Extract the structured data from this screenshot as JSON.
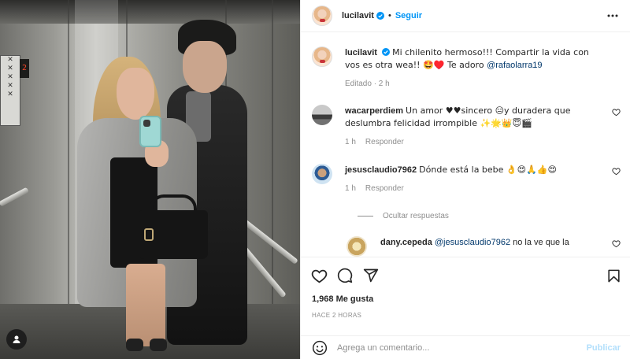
{
  "post": {
    "author": "lucilavit",
    "follow_label": "Seguir",
    "separator": "•"
  },
  "caption": {
    "username": "lucilavit",
    "text": "Mi chilenito hermoso!!! Compartir la vida con vos es otra wea!! 🤩♥️ Te adoro ",
    "mention": "@rafaolarra19",
    "meta": "Editado · 2 h"
  },
  "comments": [
    {
      "username": "wacarperdiem",
      "text": "Un amor ♥♥sincero 😑y duradera que deslumbra felicidad irrompible ✨🌟👑😇🎬",
      "time": "1 h",
      "reply_label": "Responder"
    },
    {
      "username": "jesusclaudio7962",
      "text": "Dónde está la bebe 👌😍🙏👍😍",
      "time": "1 h",
      "reply_label": "Responder",
      "hide_replies_label": "Ocultar respuestas",
      "replies": [
        {
          "username": "dany.cepeda",
          "mention": "@jesusclaudio7962",
          "text": " no la ve que la"
        }
      ]
    }
  ],
  "stats": {
    "likes": "1,968 Me gusta",
    "time_ago": "HACE 2 HORAS"
  },
  "composer": {
    "placeholder": "Agrega un comentario...",
    "publish_label": "Publicar"
  },
  "photo": {
    "floor_display": "2"
  },
  "colors": {
    "accent": "#0095f6",
    "publish_disabled": "#b2dffc",
    "muted": "#8e8e8e",
    "mention": "#00376b"
  },
  "icons": [
    "verified-icon",
    "more-options-icon",
    "like-heart-icon",
    "comment-icon",
    "share-icon",
    "bookmark-icon",
    "emoji-icon",
    "user-tag-icon"
  ]
}
